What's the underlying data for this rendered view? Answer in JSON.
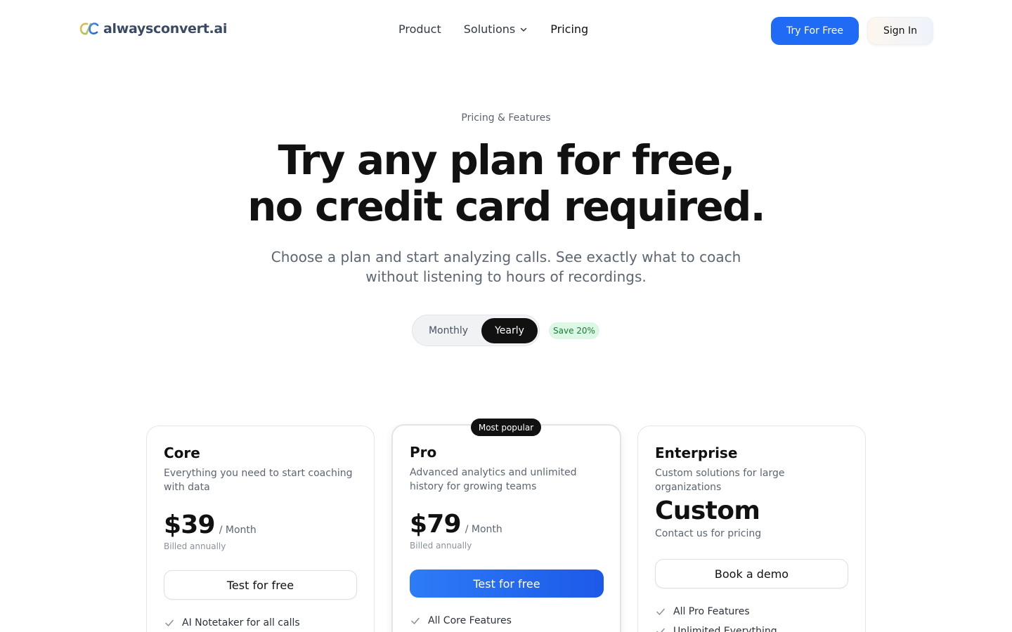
{
  "header": {
    "logo_text": "alwaysconvert.ai",
    "nav": {
      "product": "Product",
      "solutions": "Solutions",
      "pricing": "Pricing"
    },
    "try_button": "Try For Free",
    "signin_button": "Sign In"
  },
  "hero": {
    "eyebrow": "Pricing & Features",
    "title_line1": "Try any plan for free,",
    "title_line2": "no credit card required.",
    "subtitle": "Choose a plan and start analyzing calls. See exactly what to coach without listening to hours of recordings."
  },
  "billing_toggle": {
    "monthly": "Monthly",
    "yearly": "Yearly",
    "selected": "Yearly",
    "save_badge": "Save 20%"
  },
  "plans": {
    "core": {
      "name": "Core",
      "description": "Everything you need to start coaching with data",
      "price": "$39",
      "per": "/ Month",
      "billed": "Billed annually",
      "button": "Test for free",
      "features": [
        "AI Notetaker for all calls"
      ]
    },
    "pro": {
      "badge": "Most popular",
      "name": "Pro",
      "description": "Advanced analytics and unlimited history for growing teams",
      "price": "$79",
      "per": "/ Month",
      "billed": "Billed annually",
      "button": "Test for free",
      "features": [
        "All Core Features"
      ]
    },
    "enterprise": {
      "name": "Enterprise",
      "description": "Custom solutions for large organizations",
      "price": "Custom",
      "contact": "Contact us for pricing",
      "button": "Book a demo",
      "features": [
        "All Pro Features",
        "Unlimited Everything"
      ]
    }
  },
  "colors": {
    "primary_blue": "#1f6bf5",
    "dark": "#111111",
    "muted_text": "#5d6573",
    "save_badge_bg": "#dcf7e3",
    "save_badge_text": "#1b7a3a"
  }
}
